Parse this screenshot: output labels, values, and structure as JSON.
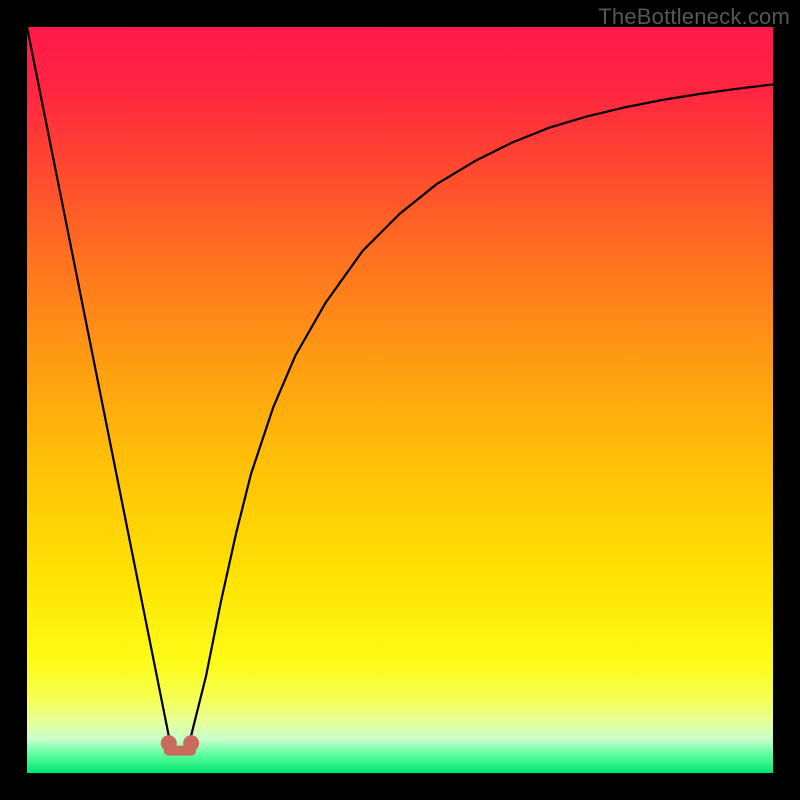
{
  "watermark": "TheBottleneck.com",
  "chart_data": {
    "type": "line",
    "title": "",
    "xlabel": "",
    "ylabel": "",
    "xlim": [
      0,
      100
    ],
    "ylim": [
      0,
      100
    ],
    "grid": false,
    "legend": false,
    "background": {
      "type": "vertical-gradient",
      "stops": [
        {
          "pos": 0.0,
          "color": "#ff1949"
        },
        {
          "pos": 0.08,
          "color": "#ff2441"
        },
        {
          "pos": 0.18,
          "color": "#ff4531"
        },
        {
          "pos": 0.3,
          "color": "#ff6e21"
        },
        {
          "pos": 0.45,
          "color": "#ff9c12"
        },
        {
          "pos": 0.6,
          "color": "#ffc407"
        },
        {
          "pos": 0.75,
          "color": "#ffe504"
        },
        {
          "pos": 0.85,
          "color": "#fdfb17"
        },
        {
          "pos": 0.9,
          "color": "#f6ff52"
        },
        {
          "pos": 0.93,
          "color": "#e8ff99"
        },
        {
          "pos": 0.955,
          "color": "#c7ffcc"
        },
        {
          "pos": 0.975,
          "color": "#5fff9e"
        },
        {
          "pos": 1.0,
          "color": "#00e56f"
        }
      ]
    },
    "series": [
      {
        "name": "bottleneck-curve",
        "color": "#000000",
        "x": [
          0,
          2,
          4,
          6,
          8,
          10,
          12,
          14,
          16,
          18,
          19,
          20,
          21,
          22,
          24,
          26,
          28,
          30,
          33,
          36,
          40,
          45,
          50,
          55,
          60,
          65,
          70,
          75,
          80,
          85,
          90,
          95,
          100
        ],
        "y": [
          100,
          90,
          80,
          70,
          60,
          50,
          40,
          30,
          20,
          10,
          5,
          3,
          3,
          5,
          13,
          23,
          32,
          40,
          49,
          56,
          63,
          70,
          75,
          79,
          82,
          84.5,
          86.5,
          88,
          89.2,
          90.2,
          91,
          91.7,
          92.3
        ]
      }
    ],
    "markers": [
      {
        "name": "min-left",
        "x": 19,
        "y": 4,
        "r": 8,
        "color": "#c96a5c"
      },
      {
        "name": "min-right",
        "x": 22,
        "y": 4,
        "r": 8,
        "color": "#c96a5c"
      }
    ],
    "min_bridge": {
      "x1": 19,
      "x2": 22,
      "y": 3,
      "color": "#c96a5c",
      "width": 10
    }
  }
}
